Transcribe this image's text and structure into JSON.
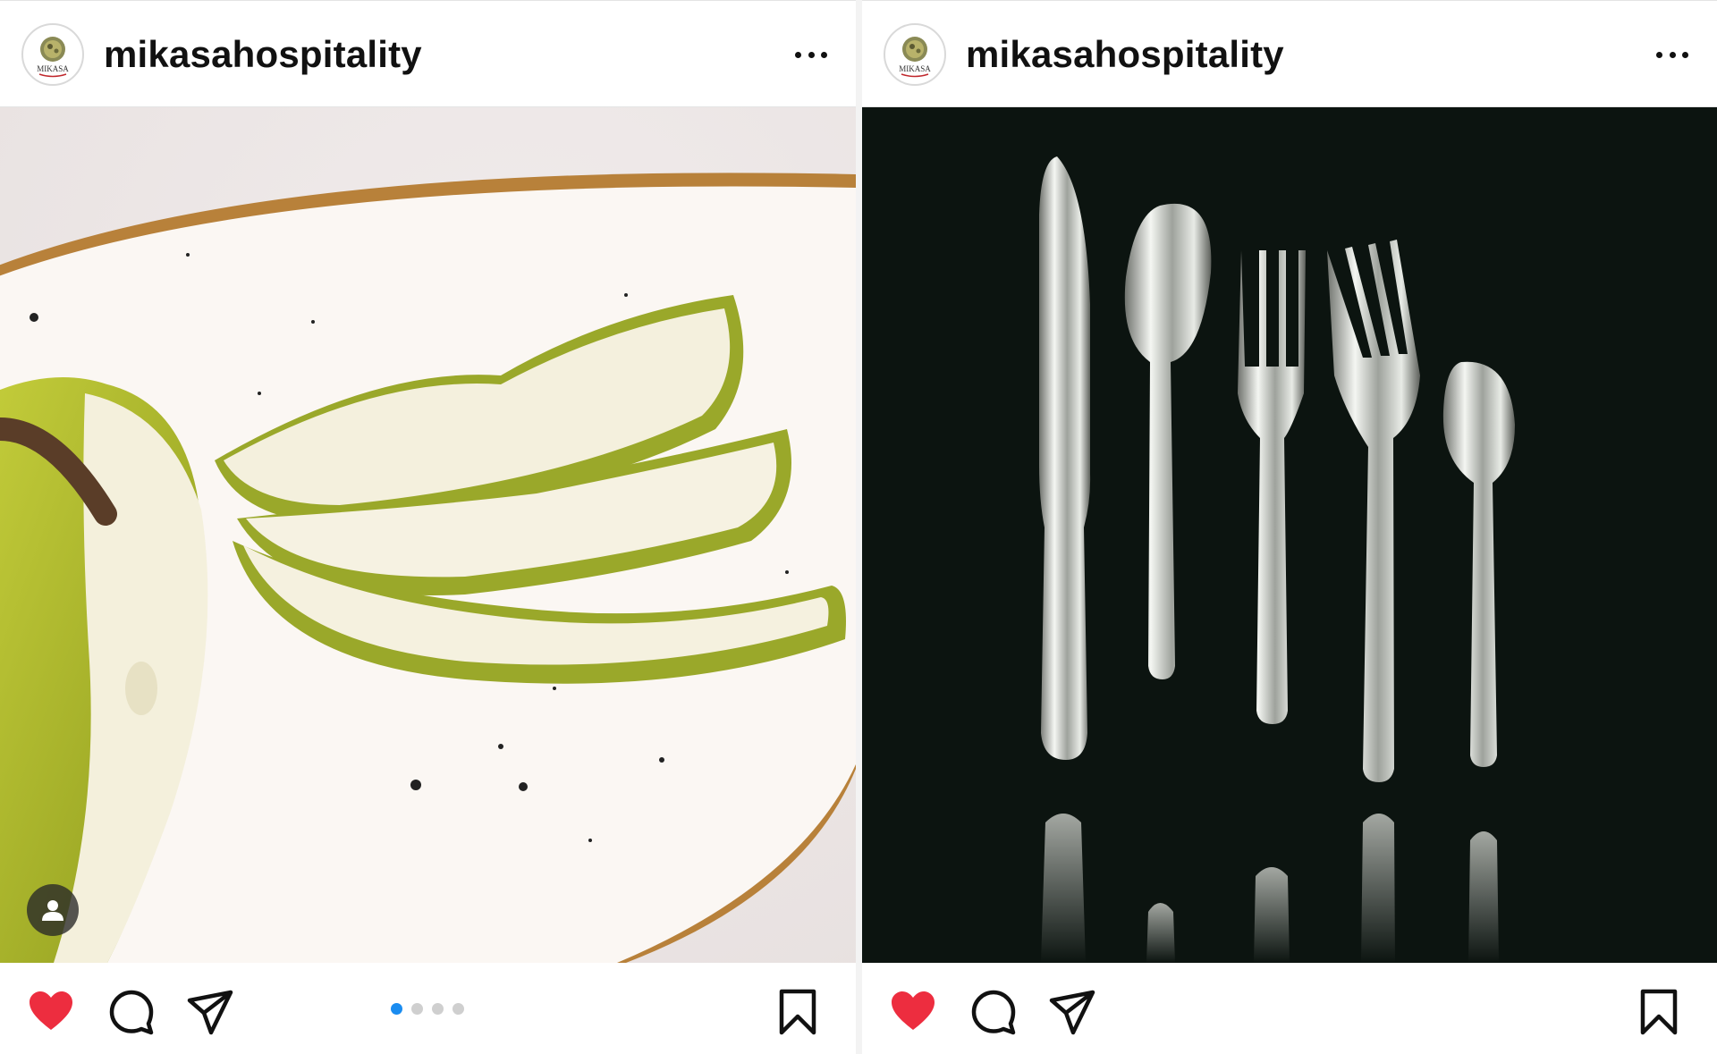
{
  "posts": [
    {
      "username": "mikasahospitality",
      "avatar_text": "MIKASA",
      "liked": true,
      "carousel": {
        "count": 4,
        "active_index": 1
      },
      "image_subject": "pear-slices-on-speckled-plate"
    },
    {
      "username": "mikasahospitality",
      "avatar_text": "MIKASA",
      "liked": true,
      "image_subject": "silver-cutlery-on-black"
    }
  ],
  "colors": {
    "like_red": "#ed2d3f",
    "carousel_active": "#1a8cf0",
    "carousel_inactive": "#cfcfcf",
    "icon_black": "#111111"
  },
  "icons": {
    "like": "heart-icon",
    "comment": "comment-icon",
    "share": "paper-plane-icon",
    "save": "bookmark-icon",
    "more": "more-dots-icon",
    "tag": "user-tag-icon"
  }
}
